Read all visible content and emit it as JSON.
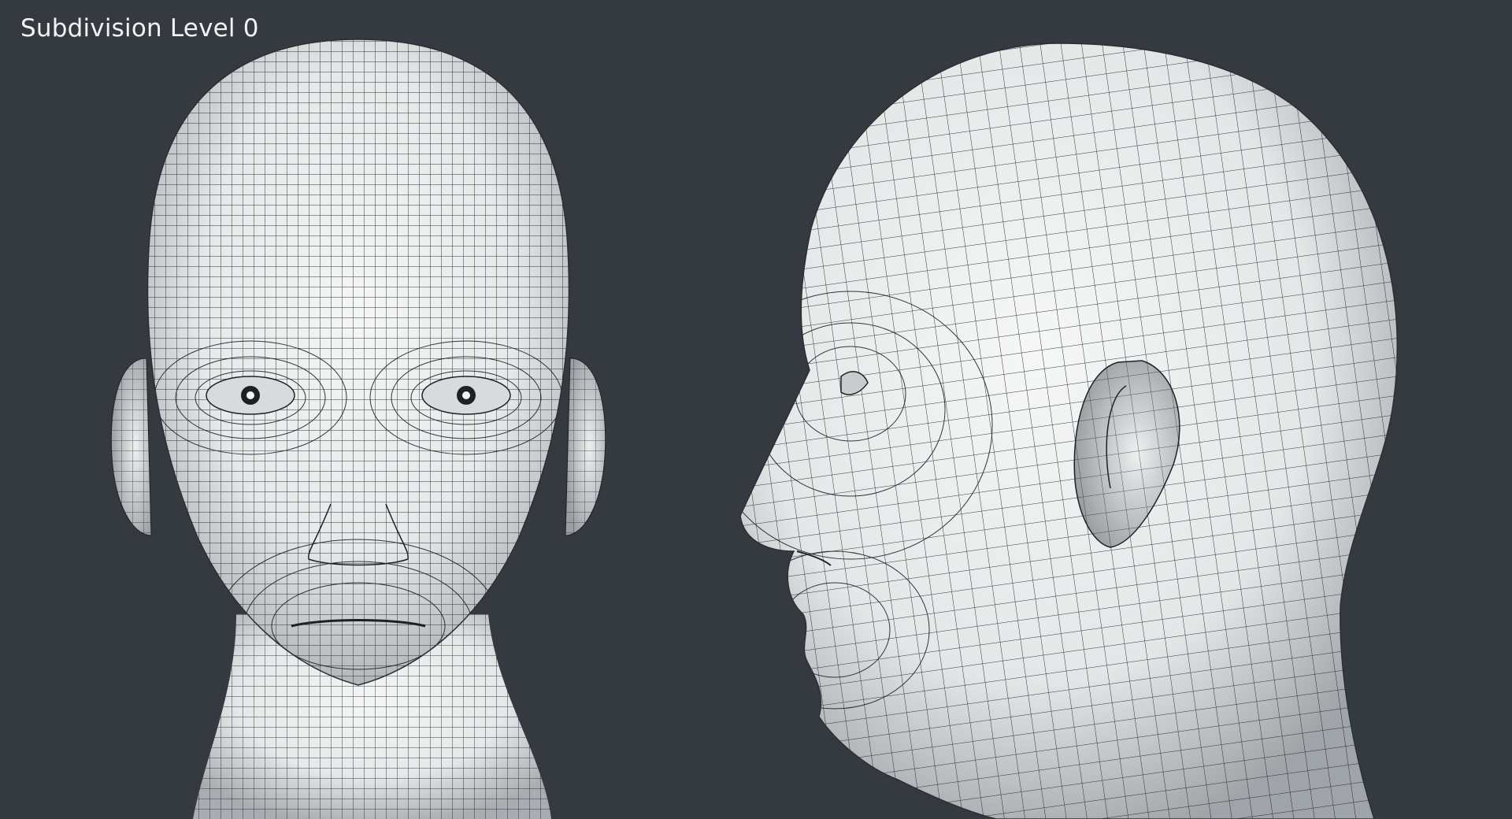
{
  "caption": "Subdivision Level 0",
  "colors": {
    "background": "#343a3f",
    "mesh_light": "#f1f2f2",
    "mesh_shade": "#a9adb1",
    "wire": "#1d2125",
    "caption_text": "#f1f3f4"
  },
  "views": [
    {
      "name": "front-view"
    },
    {
      "name": "side-view"
    }
  ]
}
